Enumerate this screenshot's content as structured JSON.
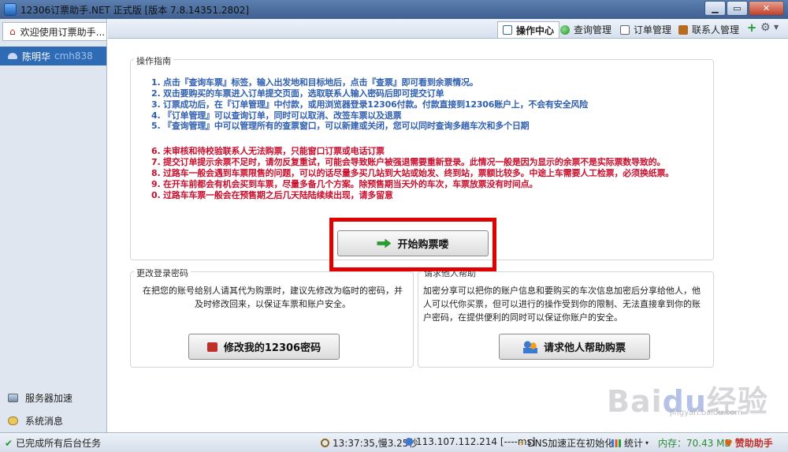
{
  "window": {
    "title": "12306订票助手.NET  正式版 [版本 7.8.14351.2802]",
    "minimize": "▁",
    "maximize": "▭",
    "close": "✕"
  },
  "sidebar": {
    "tab_label": "欢迎使用订票助手...",
    "user_name": "陈明华",
    "user_id": "cmh838",
    "footer_items": [
      {
        "label": "服务器加速",
        "icon": "server-icon"
      },
      {
        "label": "系统消息",
        "icon": "message-icon"
      }
    ]
  },
  "toolbar": {
    "tabs": [
      {
        "label": "操作中心",
        "icon": "operations-icon",
        "active": true
      },
      {
        "label": "查询管理",
        "icon": "query-icon",
        "active": false
      },
      {
        "label": "订单管理",
        "icon": "order-icon",
        "active": false
      },
      {
        "label": "联系人管理",
        "icon": "contact-icon",
        "active": false
      }
    ],
    "plus": "+",
    "gear": "⚙",
    "dropdown": "▼"
  },
  "guide": {
    "title": "操作指南",
    "blue_lines": [
      "1. 点击『查询车票』标签，输入出发地和目标地后，点击『查票』即可看到余票情况。",
      "2. 双击要购买的车票进入订单提交页面，选取联系人输入密码后即可提交订单",
      "3. 订票成功后，在『订单管理』中付款，或用浏览器登录12306付款。付款直接到12306账户上，不会有安全风险",
      "4. 『订单管理』可以查询订单，同时可以取消、改签车票以及退票",
      "5. 『查询管理』中可以管理所有的查票窗口，可以新建或关闭，您可以同时查询多趟车次和多个日期"
    ],
    "red_lines": [
      "6. 未审核和待校验联系人无法购票，只能窗口订票或电话订票",
      "7. 提交订单提示余票不足时，请勿反复重试，可能会导致账户被强退需要重新登录。此情况一般是因为显示的余票不是实际票数导致的。",
      "8. 过路车一般会遇到车票限售的问题，可以的话尽量多买几站到大站或始发、终到站，票额比较多。中途上车需要人工检票，必须换纸票。",
      "9. 在开车前都会有机会买到车票，尽量多备几个方案。除预售期当天外的车次，车票放票没有时间点。",
      "0. 过路车车票一般会在预售期之后几天陆陆续续出现，请多留意"
    ],
    "start_button": "开始购票喽"
  },
  "change_password": {
    "title": "更改登录密码",
    "description": "在把您的账号给别人请其代为购票时，建议先修改为临时的密码，并及时修改回来，以保证车票和账户安全。",
    "button": "修改我的12306密码"
  },
  "request_help": {
    "title": "请求他人帮助",
    "description": "加密分享可以把你的账户信息和要购买的车次信息加密后分享给他人，他人可以代你买票，但可以进行的操作受到你的限制、无法直接拿到你的账户密码，在提供便利的同时可以保证你账户的安全。",
    "button": "请求他人帮助购票"
  },
  "statusbar": {
    "tasks": "已完成所有后台任务",
    "time": "13:37:35,慢3.25秒",
    "ip": "113.107.112.214 [----ms]",
    "dns": "DNS加速正在初始化",
    "stats": "统计",
    "memory": "内存：70.43 MB",
    "help": "赞助助手"
  },
  "watermark": {
    "brand": "Bai",
    "brand_mid": "du",
    "brand_cn": "经验",
    "sub": "jingyan.baidu.com"
  }
}
